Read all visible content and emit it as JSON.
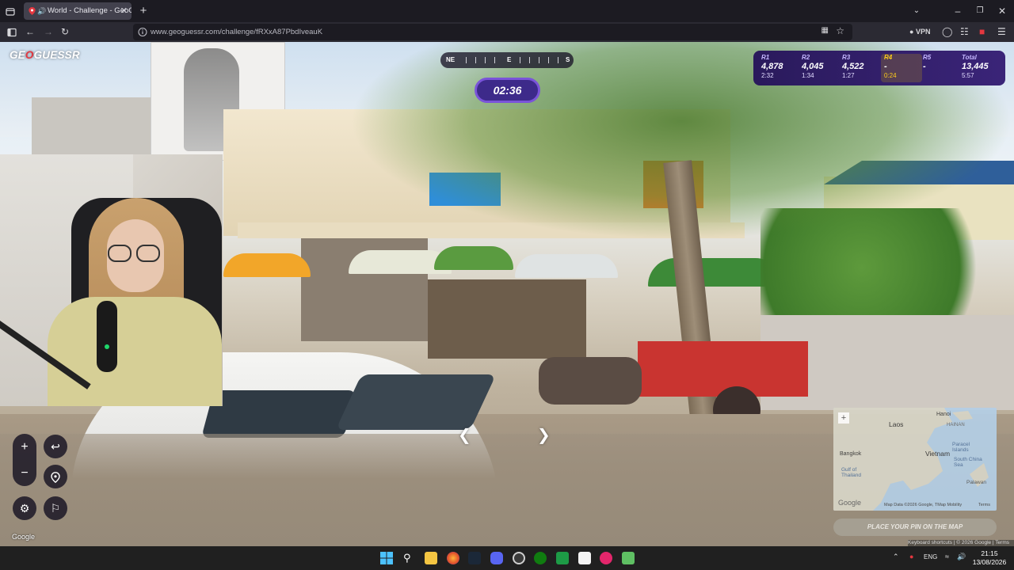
{
  "browser": {
    "tab_title": "World - Challenge - GeoGu",
    "url": "www.geoguessr.com/challenge/fRXxA87PbdIveauK",
    "vpn_label": "VPN"
  },
  "game": {
    "logo_prefix": "GE",
    "logo_o": "O",
    "logo_suffix": "GUESSR",
    "compass": {
      "ne": "NE",
      "e": "E",
      "s": "S"
    },
    "timer": "02:36",
    "rounds": [
      {
        "label": "R1",
        "points": "4,878",
        "time": "2:32"
      },
      {
        "label": "R2",
        "points": "4,045",
        "time": "1:34"
      },
      {
        "label": "R3",
        "points": "4,522",
        "time": "1:27"
      },
      {
        "label": "R4",
        "points": "-",
        "time": "0:24"
      },
      {
        "label": "R5",
        "points": "-",
        "time": ""
      }
    ],
    "total": {
      "label": "Total",
      "points": "13,445",
      "time": "5:57"
    },
    "google_left": "Google",
    "place_pin": "PLACE YOUR PIN ON THE MAP"
  },
  "minimap": {
    "labels": {
      "laos": "Laos",
      "vietnam": "Vietnam",
      "hanoi": "Hanoi",
      "hainan": "HAINAN",
      "bangkok": "Bangkok",
      "paracel": "Paracel Islands",
      "south_china": "South China Sea",
      "gulf": "Gulf of Thailand",
      "palawan": "Palawan"
    },
    "google": "Google",
    "map_data": "Map Data ©2026 Google, TMap Mobility",
    "terms": "Terms"
  },
  "attribution": "Keyboard shortcuts | © 2026 Google | Terms",
  "taskbar": {
    "lang": "ENG",
    "time": "21:15",
    "date": "13/08/2026"
  },
  "colors": {
    "accent": "#7a54d9",
    "score_bg": "#2a1a5c",
    "highlight": "#fecd19",
    "logo_red": "#e4373f"
  }
}
